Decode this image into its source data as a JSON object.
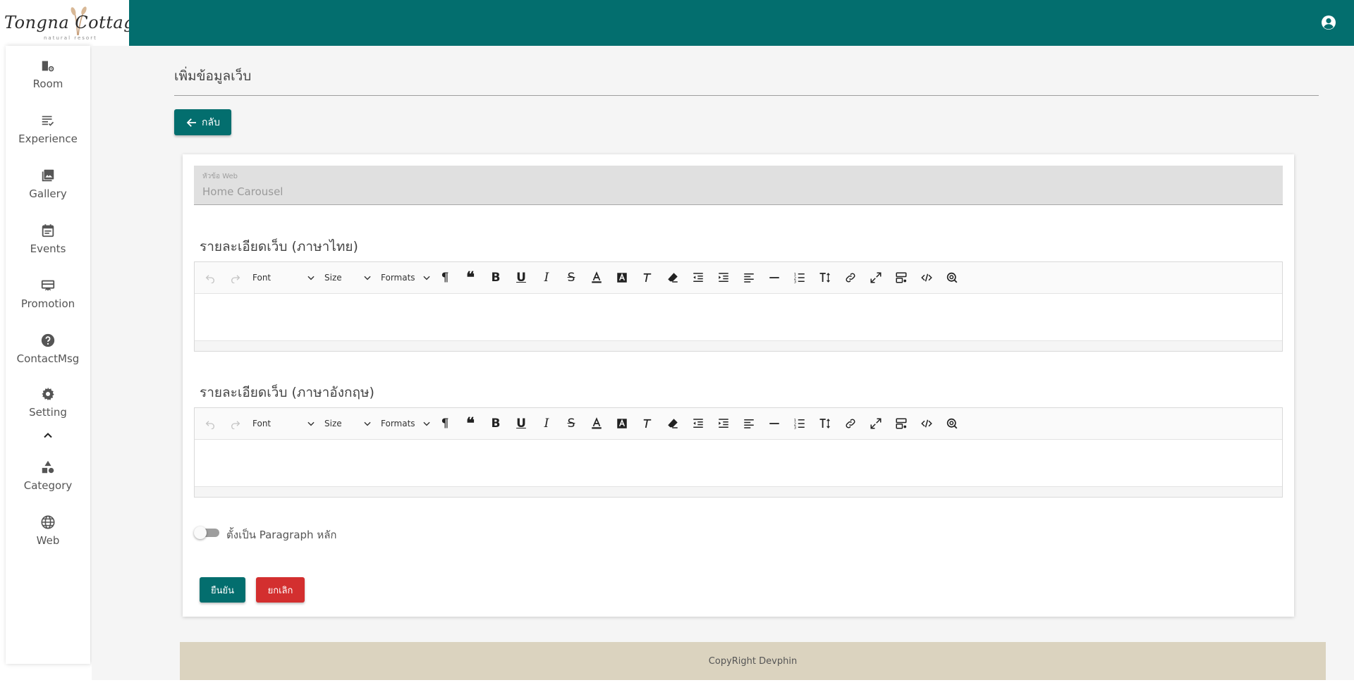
{
  "brand": {
    "logo_text": "Tongna Cottage",
    "logo_tagline": "natural resort"
  },
  "colors": {
    "primary": "#036e6e",
    "danger": "#d32f2f",
    "footer_bg": "#dbd3bf"
  },
  "sidebar": {
    "items": [
      {
        "label": "Room",
        "icon": "room-settings-icon"
      },
      {
        "label": "Experience",
        "icon": "checklist-icon"
      },
      {
        "label": "Gallery",
        "icon": "photo-library-icon"
      },
      {
        "label": "Events",
        "icon": "calendar-icon"
      },
      {
        "label": "Promotion",
        "icon": "card-giftcard-icon"
      },
      {
        "label": "ContactMsg",
        "icon": "help-circle-icon"
      },
      {
        "label": "Setting",
        "icon": "gear-icon"
      },
      {
        "label": "Category",
        "icon": "shapes-icon"
      },
      {
        "label": "Web",
        "icon": "globe-icon"
      }
    ]
  },
  "page": {
    "title": "เพิ่มข้อมูลเว็บ",
    "back_label": "กลับ"
  },
  "form": {
    "topic_label": "หัวข้อ Web",
    "topic_value": "Home Carousel",
    "thai_label": "รายละเอียดเว็บ (ภาษาไทย)",
    "english_label": "รายละเอียดเว็บ (ภาษาอังกฤษ)",
    "toolbar": {
      "font": "Font",
      "size": "Size",
      "formats": "Formats"
    },
    "toggle_label": "ตั้งเป็น Paragraph หลัก",
    "toggle_on": false,
    "confirm_label": "ยืนยัน",
    "cancel_label": "ยกเลิก"
  },
  "footer": {
    "text": "CopyRight Devphin"
  }
}
